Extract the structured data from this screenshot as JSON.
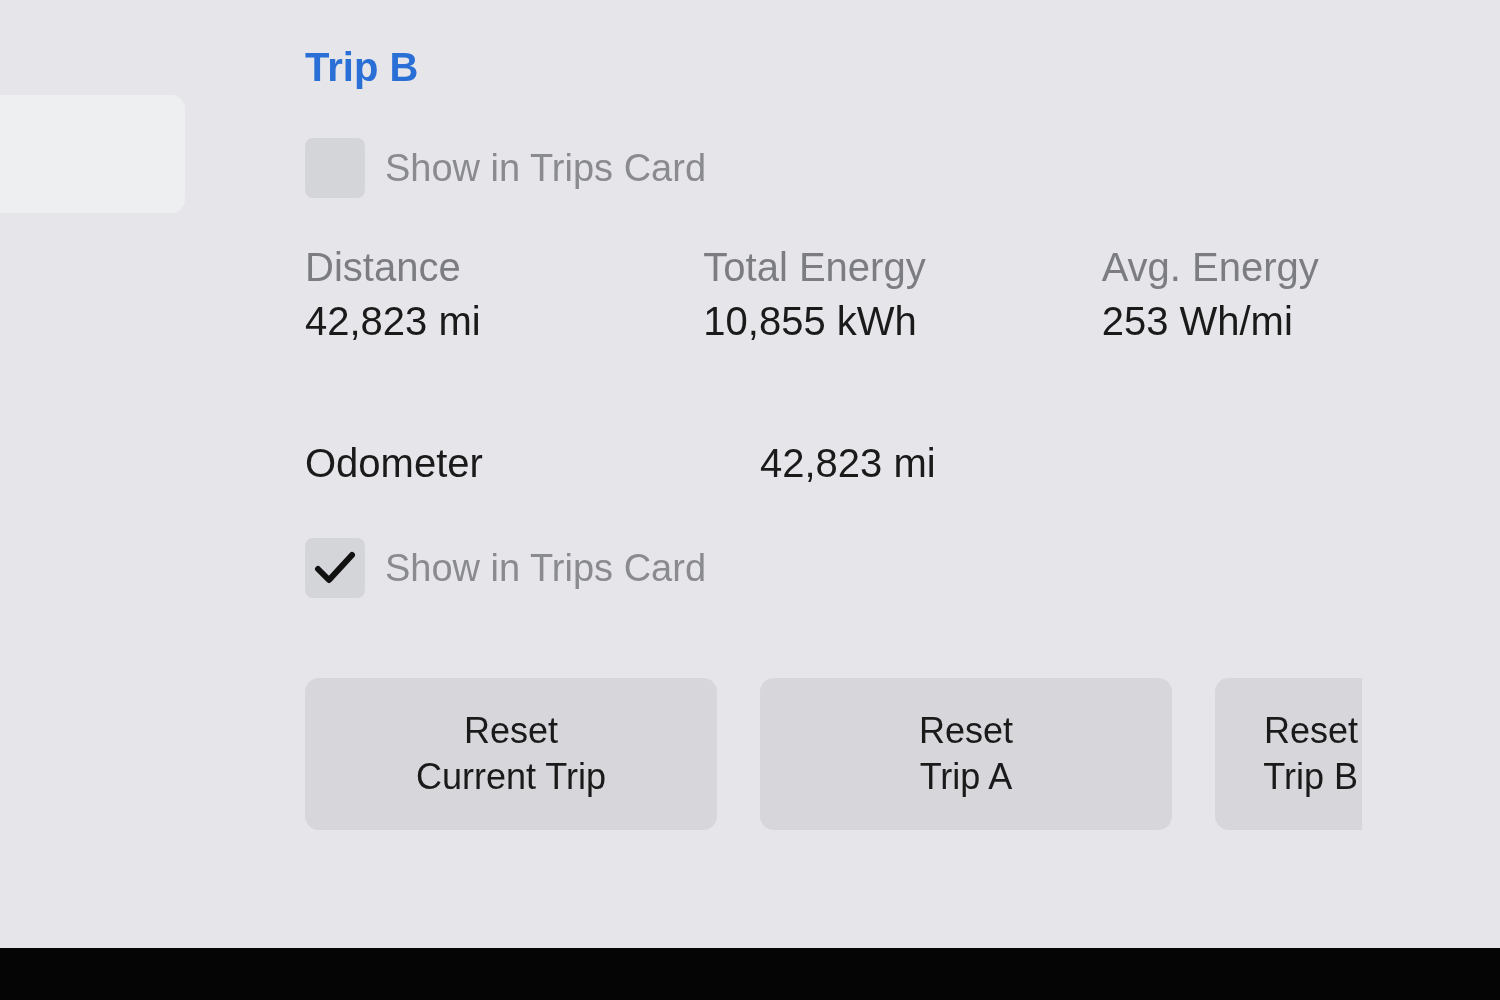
{
  "heading": "Trip B",
  "trip_option": {
    "label": "Show in Trips Card",
    "checked": false
  },
  "stats": [
    {
      "label": "Distance",
      "value": "42,823 mi"
    },
    {
      "label": "Total Energy",
      "value": "10,855 kWh"
    },
    {
      "label": "Avg. Energy",
      "value": "253 Wh/mi"
    }
  ],
  "odometer": {
    "label": "Odometer",
    "value": "42,823 mi"
  },
  "odometer_option": {
    "label": "Show in Trips Card",
    "checked": true
  },
  "buttons": [
    {
      "label": "Reset\nCurrent Trip"
    },
    {
      "label": "Reset\nTrip A"
    },
    {
      "label": "Reset\nTrip B"
    }
  ]
}
